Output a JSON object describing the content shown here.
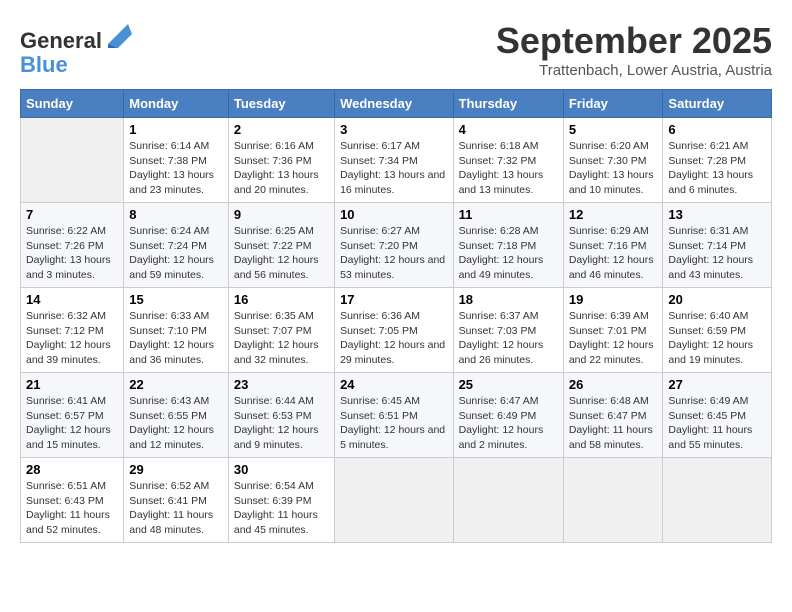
{
  "header": {
    "logo_line1": "General",
    "logo_line2": "Blue",
    "month": "September 2025",
    "location": "Trattenbach, Lower Austria, Austria"
  },
  "days_of_week": [
    "Sunday",
    "Monday",
    "Tuesday",
    "Wednesday",
    "Thursday",
    "Friday",
    "Saturday"
  ],
  "weeks": [
    [
      {
        "day": "",
        "empty": true
      },
      {
        "day": "1",
        "sunrise": "6:14 AM",
        "sunset": "7:38 PM",
        "daylight": "13 hours and 23 minutes."
      },
      {
        "day": "2",
        "sunrise": "6:16 AM",
        "sunset": "7:36 PM",
        "daylight": "13 hours and 20 minutes."
      },
      {
        "day": "3",
        "sunrise": "6:17 AM",
        "sunset": "7:34 PM",
        "daylight": "13 hours and 16 minutes."
      },
      {
        "day": "4",
        "sunrise": "6:18 AM",
        "sunset": "7:32 PM",
        "daylight": "13 hours and 13 minutes."
      },
      {
        "day": "5",
        "sunrise": "6:20 AM",
        "sunset": "7:30 PM",
        "daylight": "13 hours and 10 minutes."
      },
      {
        "day": "6",
        "sunrise": "6:21 AM",
        "sunset": "7:28 PM",
        "daylight": "13 hours and 6 minutes."
      }
    ],
    [
      {
        "day": "7",
        "sunrise": "6:22 AM",
        "sunset": "7:26 PM",
        "daylight": "13 hours and 3 minutes."
      },
      {
        "day": "8",
        "sunrise": "6:24 AM",
        "sunset": "7:24 PM",
        "daylight": "12 hours and 59 minutes."
      },
      {
        "day": "9",
        "sunrise": "6:25 AM",
        "sunset": "7:22 PM",
        "daylight": "12 hours and 56 minutes."
      },
      {
        "day": "10",
        "sunrise": "6:27 AM",
        "sunset": "7:20 PM",
        "daylight": "12 hours and 53 minutes."
      },
      {
        "day": "11",
        "sunrise": "6:28 AM",
        "sunset": "7:18 PM",
        "daylight": "12 hours and 49 minutes."
      },
      {
        "day": "12",
        "sunrise": "6:29 AM",
        "sunset": "7:16 PM",
        "daylight": "12 hours and 46 minutes."
      },
      {
        "day": "13",
        "sunrise": "6:31 AM",
        "sunset": "7:14 PM",
        "daylight": "12 hours and 43 minutes."
      }
    ],
    [
      {
        "day": "14",
        "sunrise": "6:32 AM",
        "sunset": "7:12 PM",
        "daylight": "12 hours and 39 minutes."
      },
      {
        "day": "15",
        "sunrise": "6:33 AM",
        "sunset": "7:10 PM",
        "daylight": "12 hours and 36 minutes."
      },
      {
        "day": "16",
        "sunrise": "6:35 AM",
        "sunset": "7:07 PM",
        "daylight": "12 hours and 32 minutes."
      },
      {
        "day": "17",
        "sunrise": "6:36 AM",
        "sunset": "7:05 PM",
        "daylight": "12 hours and 29 minutes."
      },
      {
        "day": "18",
        "sunrise": "6:37 AM",
        "sunset": "7:03 PM",
        "daylight": "12 hours and 26 minutes."
      },
      {
        "day": "19",
        "sunrise": "6:39 AM",
        "sunset": "7:01 PM",
        "daylight": "12 hours and 22 minutes."
      },
      {
        "day": "20",
        "sunrise": "6:40 AM",
        "sunset": "6:59 PM",
        "daylight": "12 hours and 19 minutes."
      }
    ],
    [
      {
        "day": "21",
        "sunrise": "6:41 AM",
        "sunset": "6:57 PM",
        "daylight": "12 hours and 15 minutes."
      },
      {
        "day": "22",
        "sunrise": "6:43 AM",
        "sunset": "6:55 PM",
        "daylight": "12 hours and 12 minutes."
      },
      {
        "day": "23",
        "sunrise": "6:44 AM",
        "sunset": "6:53 PM",
        "daylight": "12 hours and 9 minutes."
      },
      {
        "day": "24",
        "sunrise": "6:45 AM",
        "sunset": "6:51 PM",
        "daylight": "12 hours and 5 minutes."
      },
      {
        "day": "25",
        "sunrise": "6:47 AM",
        "sunset": "6:49 PM",
        "daylight": "12 hours and 2 minutes."
      },
      {
        "day": "26",
        "sunrise": "6:48 AM",
        "sunset": "6:47 PM",
        "daylight": "11 hours and 58 minutes."
      },
      {
        "day": "27",
        "sunrise": "6:49 AM",
        "sunset": "6:45 PM",
        "daylight": "11 hours and 55 minutes."
      }
    ],
    [
      {
        "day": "28",
        "sunrise": "6:51 AM",
        "sunset": "6:43 PM",
        "daylight": "11 hours and 52 minutes."
      },
      {
        "day": "29",
        "sunrise": "6:52 AM",
        "sunset": "6:41 PM",
        "daylight": "11 hours and 48 minutes."
      },
      {
        "day": "30",
        "sunrise": "6:54 AM",
        "sunset": "6:39 PM",
        "daylight": "11 hours and 45 minutes."
      },
      {
        "day": "",
        "empty": true
      },
      {
        "day": "",
        "empty": true
      },
      {
        "day": "",
        "empty": true
      },
      {
        "day": "",
        "empty": true
      }
    ]
  ],
  "labels": {
    "sunrise": "Sunrise:",
    "sunset": "Sunset:",
    "daylight": "Daylight:"
  }
}
